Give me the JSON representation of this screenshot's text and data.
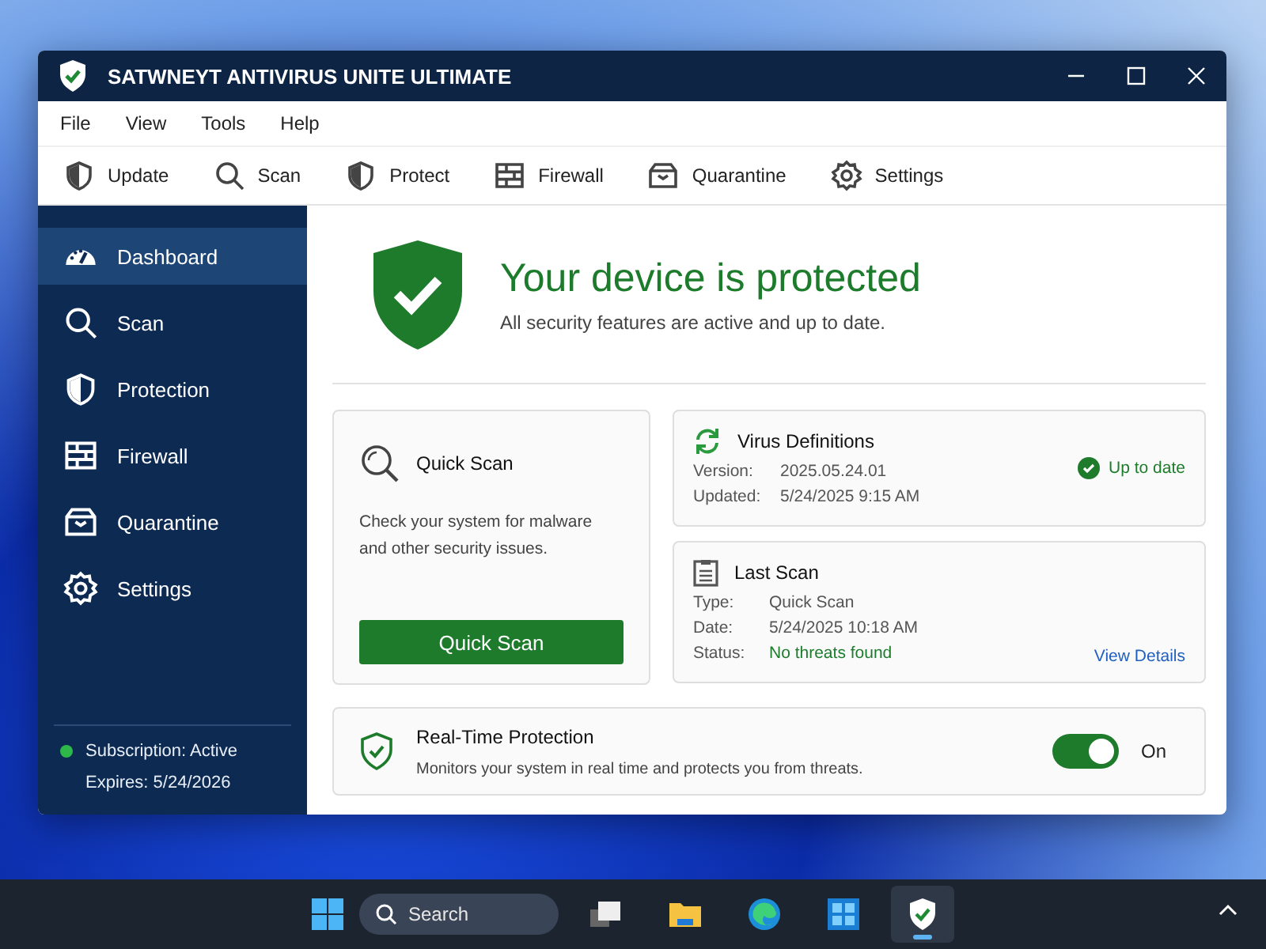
{
  "window": {
    "title": "SATWNEYT ANTIVIRUS UNITE ULTIMATE"
  },
  "menu": [
    "File",
    "View",
    "Tools",
    "Help"
  ],
  "toolbar": [
    {
      "label": "Update",
      "kind": "shield"
    },
    {
      "label": "Scan",
      "kind": "search"
    },
    {
      "label": "Protect",
      "kind": "shield"
    },
    {
      "label": "Firewall",
      "kind": "wall"
    },
    {
      "label": "Quarantine",
      "kind": "box"
    },
    {
      "label": "Settings",
      "kind": "gear"
    }
  ],
  "sidebar": {
    "items": [
      {
        "label": "Dashboard",
        "kind": "gauge",
        "selected": true
      },
      {
        "label": "Scan",
        "kind": "search",
        "selected": false
      },
      {
        "label": "Protection",
        "kind": "shield",
        "selected": false
      },
      {
        "label": "Firewall",
        "kind": "wall",
        "selected": false
      },
      {
        "label": "Quarantine",
        "kind": "box",
        "selected": false
      },
      {
        "label": "Settings",
        "kind": "gear",
        "selected": false
      }
    ],
    "subscription": "Subscription: Active",
    "expires": "Expires: 5/24/2026"
  },
  "hero": {
    "title": "Your device is protected",
    "subtitle": "All security features are active and up to date."
  },
  "quick_scan": {
    "title": "Quick Scan",
    "description": "Check your system for malware and other security issues.",
    "button": "Quick Scan"
  },
  "virus_definitions": {
    "title": "Virus Definitions",
    "rows": [
      {
        "label": "Version:",
        "value": "2025.05.24.01"
      },
      {
        "label": "Updated:",
        "value": "5/24/2025 9:15 AM"
      }
    ],
    "status": "Up to date"
  },
  "last_scan": {
    "title": "Last Scan",
    "rows": [
      {
        "label": "Type:",
        "value": "Quick Scan",
        "kind": "plain"
      },
      {
        "label": "Date:",
        "value": "5/24/2025 10:18 AM",
        "kind": "plain"
      },
      {
        "label": "Status:",
        "value": "No threats found",
        "kind": "good"
      }
    ],
    "link": "View Details"
  },
  "realtime": {
    "title": "Real-Time Protection",
    "description": "Monitors your system in real time and protects you from threats.",
    "on": true,
    "state_label": "On"
  },
  "taskbar": {
    "search": {
      "placeholder": "Search"
    },
    "apps": [
      {
        "kind": "tasks",
        "selected": false
      },
      {
        "kind": "folder",
        "selected": false
      },
      {
        "kind": "browser",
        "selected": false
      },
      {
        "kind": "store",
        "selected": false
      },
      {
        "kind": "shield",
        "selected": true
      }
    ]
  }
}
